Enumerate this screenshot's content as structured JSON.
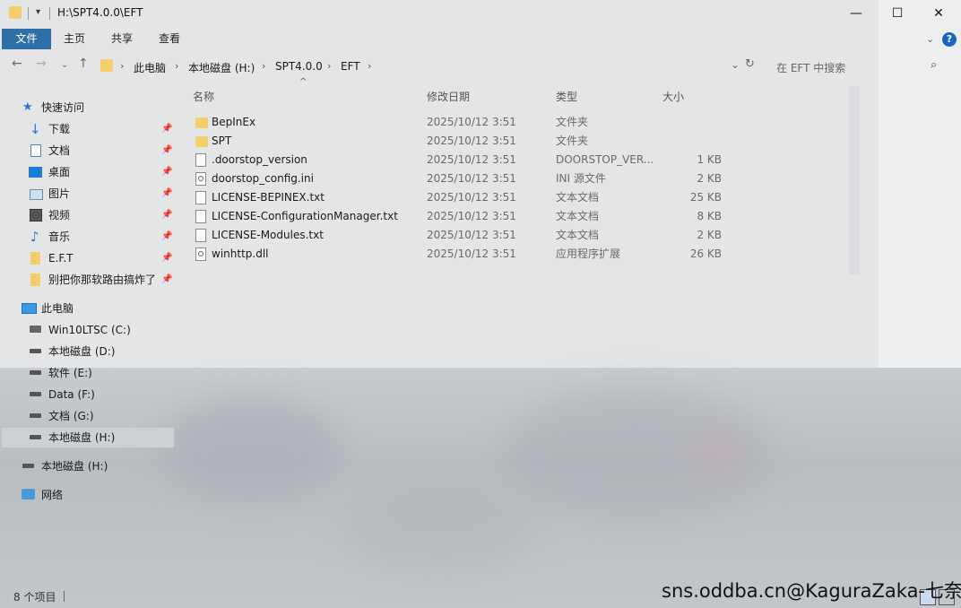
{
  "window": {
    "title": "H:\\SPT4.0.0\\EFT",
    "controls": {
      "minimize": "—",
      "maximize": "☐",
      "close": "✕"
    }
  },
  "ribbon": {
    "tabs": [
      "文件",
      "主页",
      "共享",
      "查看"
    ]
  },
  "address": {
    "crumbs": [
      "此电脑",
      "本地磁盘 (H:)",
      "SPT4.0.0",
      "EFT"
    ],
    "search_placeholder": "在 EFT 中搜索"
  },
  "sidebar": {
    "quick_access": "快速访问",
    "quick_items": [
      {
        "label": "下载",
        "icon": "download-icon",
        "pinned": true
      },
      {
        "label": "文档",
        "icon": "document-icon",
        "pinned": true
      },
      {
        "label": "桌面",
        "icon": "desktop-icon",
        "pinned": true
      },
      {
        "label": "图片",
        "icon": "picture-icon",
        "pinned": true
      },
      {
        "label": "视频",
        "icon": "video-icon",
        "pinned": true
      },
      {
        "label": "音乐",
        "icon": "music-icon",
        "pinned": true
      },
      {
        "label": "E.F.T",
        "icon": "folder-icon",
        "pinned": true
      },
      {
        "label": "别把你那软路由搞炸了",
        "icon": "folder-icon",
        "pinned": true
      }
    ],
    "this_pc": "此电脑",
    "drives": [
      {
        "label": "Win10LTSC (C:)",
        "icon": "system-drive-icon"
      },
      {
        "label": "本地磁盘 (D:)",
        "icon": "drive-icon"
      },
      {
        "label": "软件 (E:)",
        "icon": "drive-icon"
      },
      {
        "label": "Data (F:)",
        "icon": "drive-icon"
      },
      {
        "label": "文档 (G:)",
        "icon": "drive-icon"
      },
      {
        "label": "本地磁盘 (H:)",
        "icon": "drive-icon",
        "selected": true
      }
    ],
    "extra_drive": "本地磁盘 (H:)",
    "network": "网络"
  },
  "columns": {
    "name": "名称",
    "date": "修改日期",
    "type": "类型",
    "size": "大小"
  },
  "files": [
    {
      "name": "BepInEx",
      "date": "2025/10/12 3:51",
      "type": "文件夹",
      "size": "",
      "icon": "folder-icon"
    },
    {
      "name": "SPT",
      "date": "2025/10/12 3:51",
      "type": "文件夹",
      "size": "",
      "icon": "folder-icon"
    },
    {
      "name": ".doorstop_version",
      "date": "2025/10/12 3:51",
      "type": "DOORSTOP_VER...",
      "size": "1 KB",
      "icon": "file-icon"
    },
    {
      "name": "doorstop_config.ini",
      "date": "2025/10/12 3:51",
      "type": "INI 源文件",
      "size": "2 KB",
      "icon": "settings-file-icon"
    },
    {
      "name": "LICENSE-BEPINEX.txt",
      "date": "2025/10/12 3:51",
      "type": "文本文档",
      "size": "25 KB",
      "icon": "text-file-icon"
    },
    {
      "name": "LICENSE-ConfigurationManager.txt",
      "date": "2025/10/12 3:51",
      "type": "文本文档",
      "size": "8 KB",
      "icon": "text-file-icon"
    },
    {
      "name": "LICENSE-Modules.txt",
      "date": "2025/10/12 3:51",
      "type": "文本文档",
      "size": "2 KB",
      "icon": "text-file-icon"
    },
    {
      "name": "winhttp.dll",
      "date": "2025/10/12 3:51",
      "type": "应用程序扩展",
      "size": "26 KB",
      "icon": "dll-file-icon"
    }
  ],
  "status": {
    "item_count": "8 个项目"
  },
  "watermark": "sns.oddba.cn@KaguraZaka-七奈"
}
